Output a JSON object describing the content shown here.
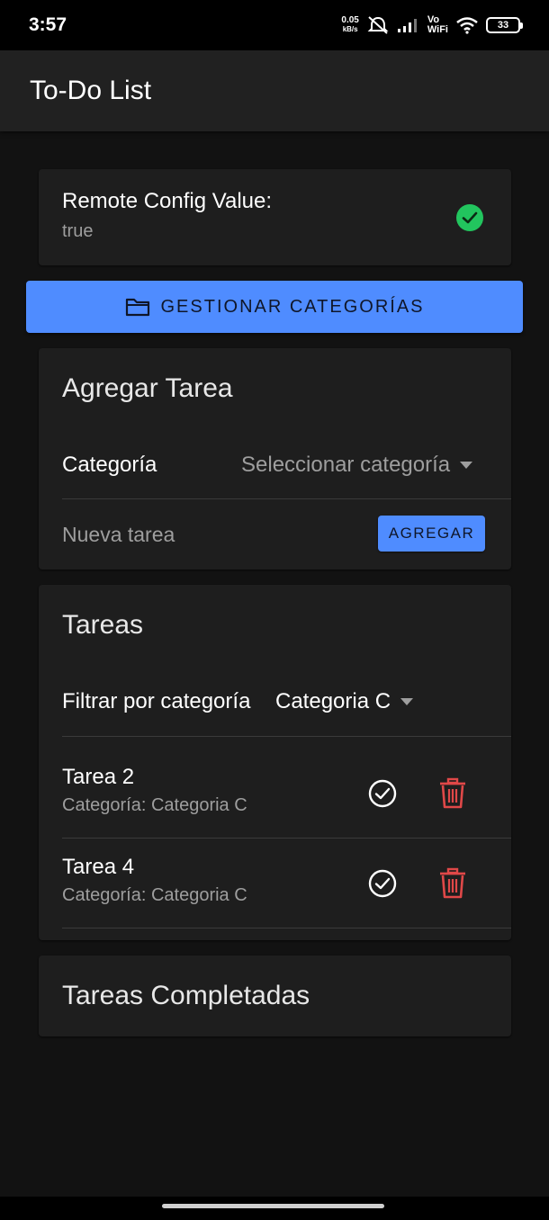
{
  "status_bar": {
    "time": "3:57",
    "net_speed_value": "0.05",
    "net_speed_unit": "kB/s",
    "vowifi_top": "Vo",
    "vowifi_bottom": "WiFi",
    "battery": "33",
    "icons": [
      "mute-icon",
      "signal-icon",
      "wifi-icon",
      "battery-icon"
    ]
  },
  "app_bar": {
    "title": "To-Do List"
  },
  "remote_config": {
    "label": "Remote Config Value:",
    "value": "true",
    "status_icon": "check-circle-icon",
    "status_color": "#22c55e"
  },
  "manage_button": {
    "label": "GESTIONAR CATEGORÍAS",
    "icon": "folder-icon"
  },
  "add_task": {
    "title": "Agregar Tarea",
    "category_label": "Categoría",
    "category_placeholder": "Seleccionar categoría",
    "task_placeholder": "Nueva tarea",
    "add_button": "AGREGAR"
  },
  "tasks": {
    "title": "Tareas",
    "filter_label": "Filtrar por categoría",
    "filter_value": "Categoria C",
    "items": [
      {
        "name": "Tarea 2",
        "category": "Categoría: Categoria C"
      },
      {
        "name": "Tarea 4",
        "category": "Categoría: Categoria C"
      }
    ]
  },
  "completed": {
    "title": "Tareas Completadas"
  },
  "colors": {
    "accent": "#4f8cff",
    "delete": "#e04848",
    "background": "#121212",
    "card": "#1e1e1e"
  }
}
